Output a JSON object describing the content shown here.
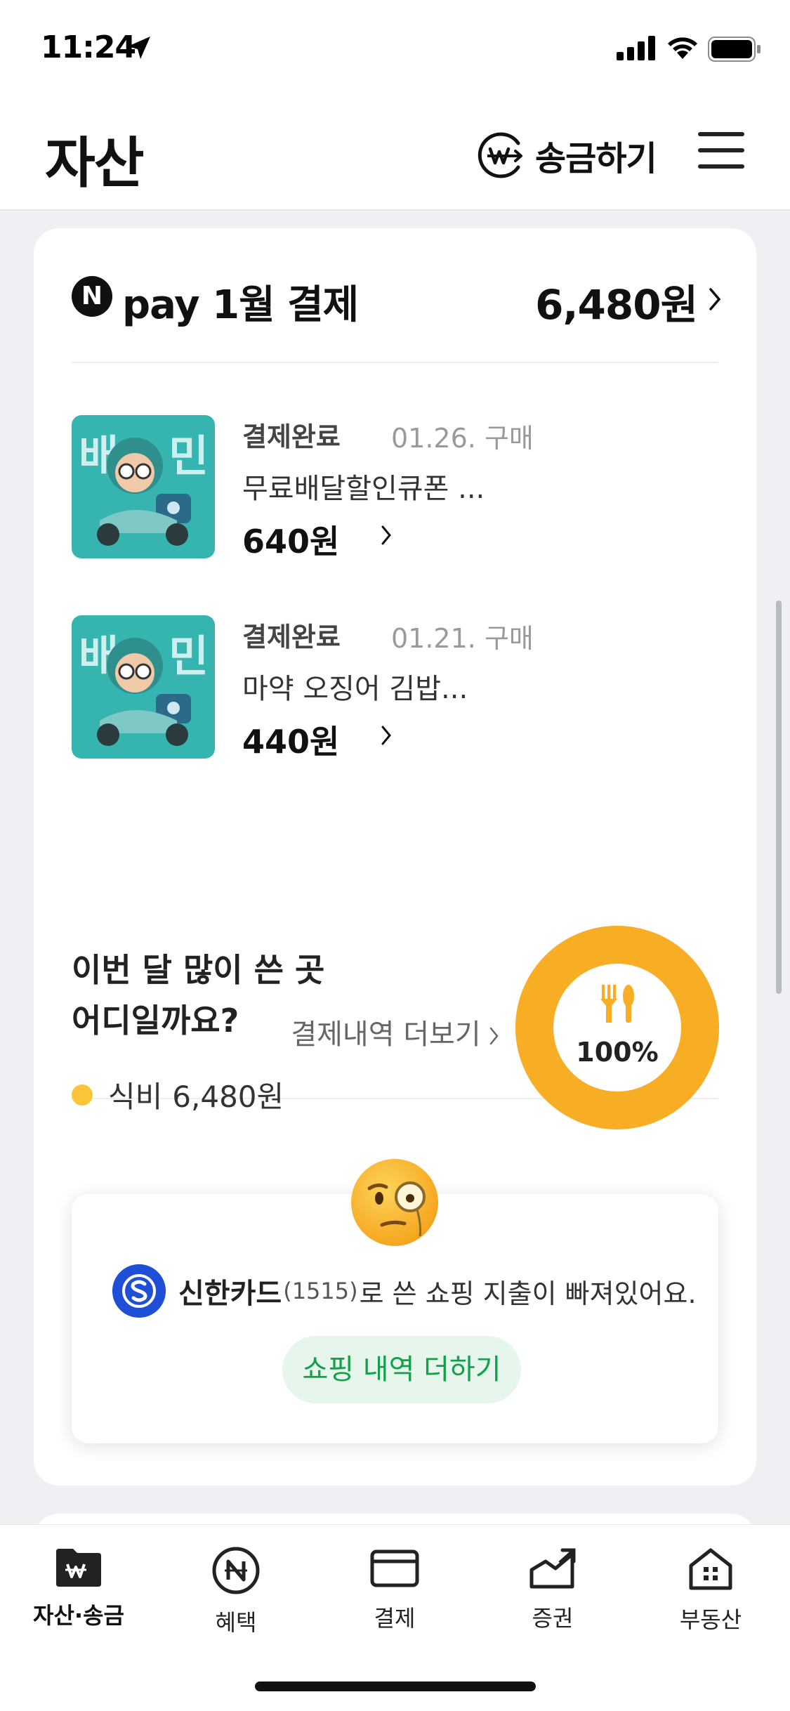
{
  "status_bar": {
    "time": "11:24"
  },
  "header": {
    "title": "자산",
    "send_label": "송금하기"
  },
  "pay_summary": {
    "title": "pay 1월 결제",
    "total": "6,480원"
  },
  "payments": [
    {
      "status": "결제완료",
      "date": "01.26. 구매",
      "name": "무료배달할인큐폰 ...",
      "price": "640원"
    },
    {
      "status": "결제완료",
      "date": "01.21. 구매",
      "name": "마약 오징어 김밥...",
      "price": "440원"
    }
  ],
  "more_link": "결제내역 더보기",
  "spending": {
    "question_line1": "이번 달 많이 쓴 곳",
    "question_line2": "어디일까요?",
    "legend_category": "식비",
    "legend_amount": "6,480원",
    "percent_label": "100%",
    "chart_data": {
      "type": "pie",
      "categories": [
        "식비"
      ],
      "values": [
        100
      ],
      "colors": [
        "#f8ae24"
      ]
    }
  },
  "notice": {
    "card_name": "신한카드",
    "card_number": "(1515)",
    "message": "로 쓴 쇼핑 지출이 빠져있어요.",
    "button_label": "쇼핑 내역 더하기"
  },
  "tabs": [
    {
      "label": "자산·송금",
      "active": true
    },
    {
      "label": "혜택",
      "active": false
    },
    {
      "label": "결제",
      "active": false
    },
    {
      "label": "증권",
      "active": false
    },
    {
      "label": "부동산",
      "active": false
    }
  ],
  "colors": {
    "accent_yellow": "#f8ae24",
    "legend_yellow": "#fbc53a",
    "green": "#14a04a",
    "shinhan_blue": "#1e4fd6"
  }
}
